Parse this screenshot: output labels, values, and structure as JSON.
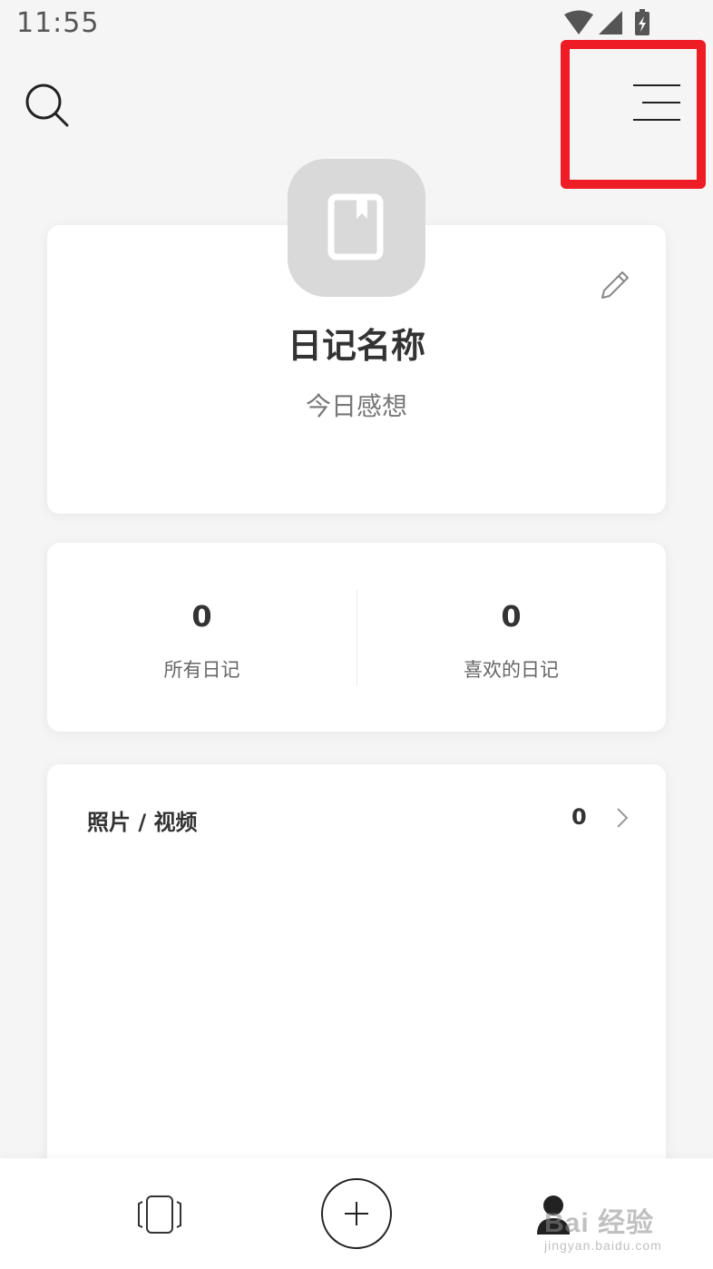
{
  "status_bar": {
    "time": "11:55"
  },
  "profile": {
    "diary_name": "日记名称",
    "diary_description": "今日感想"
  },
  "stats": [
    {
      "value": "0",
      "label": "所有日记"
    },
    {
      "value": "0",
      "label": "喜欢的日记"
    }
  ],
  "media": {
    "title": "照片 / 视频",
    "count": "0"
  },
  "watermark": {
    "brand": "Bai 经验",
    "url": "jingyan.baidu.com"
  },
  "colors": {
    "highlight": "#ee1c25",
    "cover": "#d9d9d9",
    "background": "#f5f5f5"
  },
  "icons": {
    "search": "search-icon",
    "menu": "menu-icon",
    "edit": "pencil-icon",
    "cover": "book-icon",
    "pages": "pages-icon",
    "add": "plus-icon",
    "profile": "person-icon"
  }
}
